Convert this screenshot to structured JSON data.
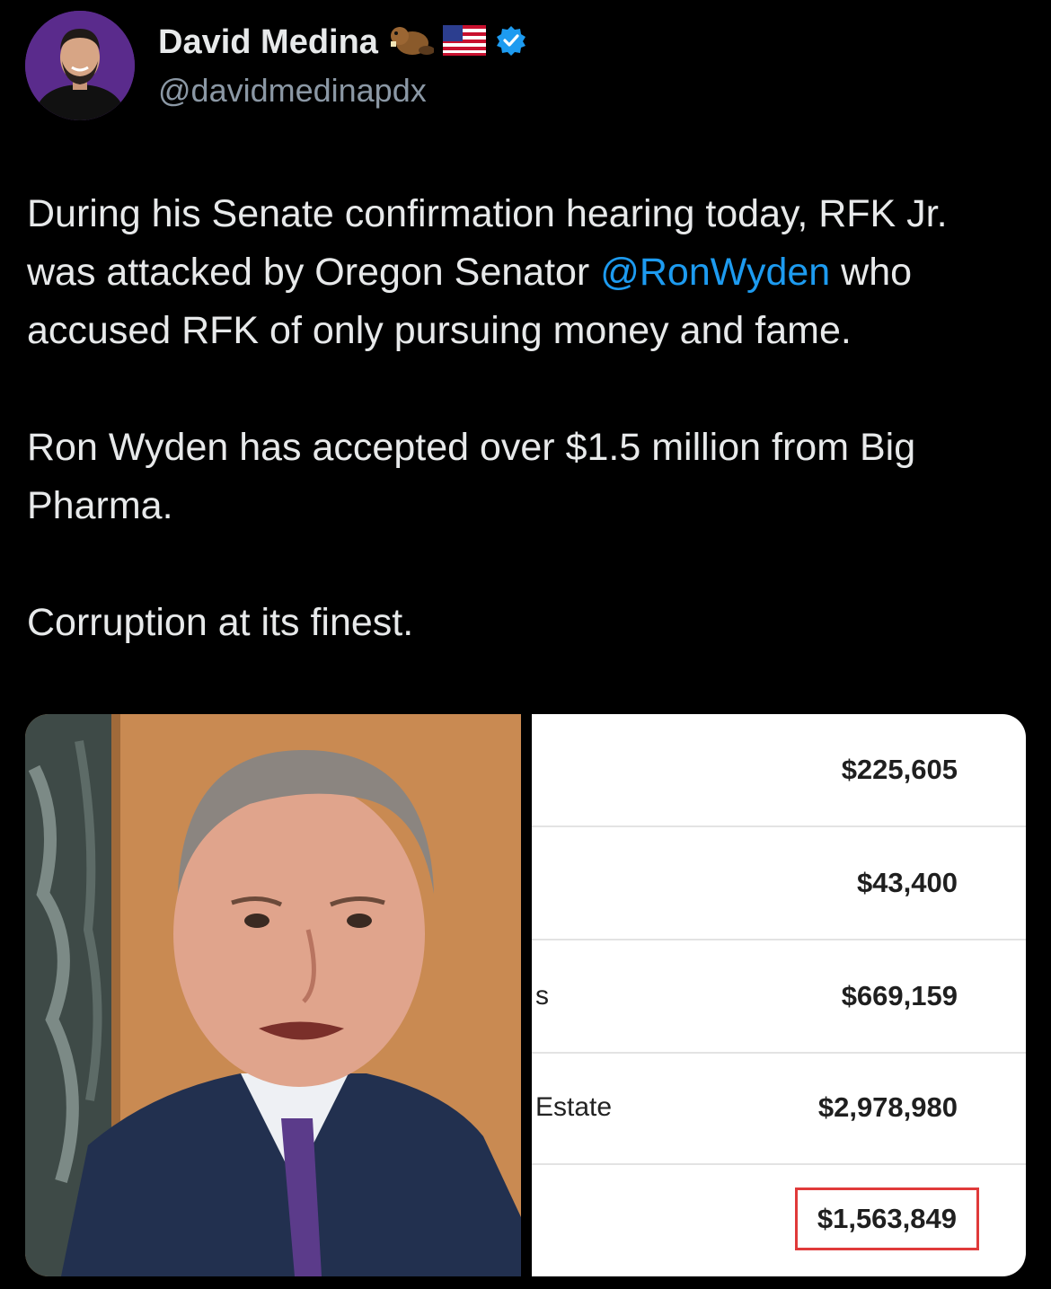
{
  "author": {
    "name": "David Medina",
    "handle": "@davidmedinapdx",
    "badges": [
      "beaver-icon",
      "us-flag-icon",
      "verified-icon"
    ],
    "verified_color": "#1d9bf0"
  },
  "tweet": {
    "p1_before": "During his Senate confirmation hearing today, RFK Jr. was attacked by Oregon Senator ",
    "mention": "@RonWyden",
    "p1_after": " who accused RFK of only pursuing money and fame.",
    "p2": "Ron Wyden has accepted over $1.5 million from Big Pharma.",
    "p3": "Corruption at its finest."
  },
  "media": {
    "rows": [
      {
        "label": "",
        "value": "$225,605"
      },
      {
        "label": "",
        "value": "$43,400"
      },
      {
        "label": "s",
        "value": "$669,159"
      },
      {
        "label": "Estate",
        "value": "$2,978,980"
      },
      {
        "label": "",
        "value": "$1,563,849",
        "highlight_color": "#e03a3a"
      }
    ]
  }
}
